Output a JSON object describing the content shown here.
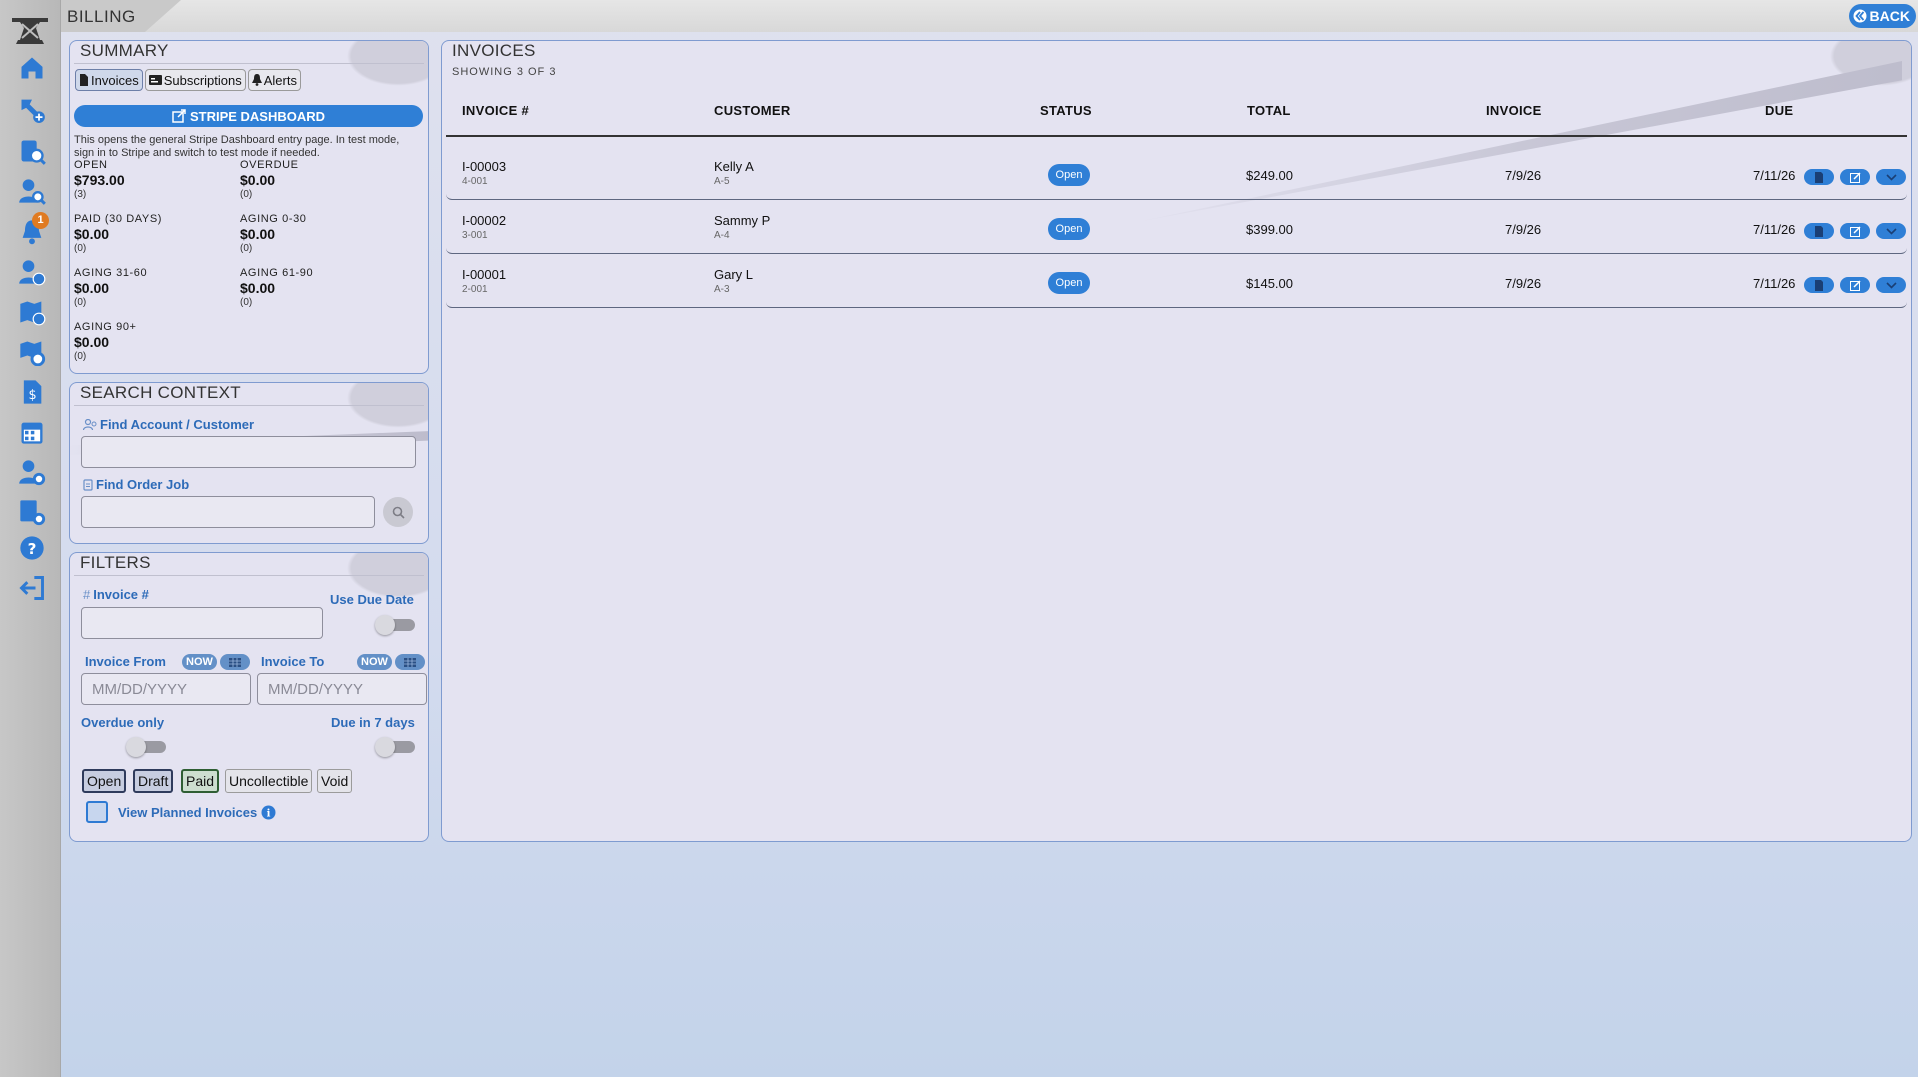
{
  "app": {
    "title": "BILLING",
    "back_label": "BACK",
    "notification_count": "1"
  },
  "nav": {
    "items": [
      "home-icon",
      "tool-add-icon",
      "clipboard-search-icon",
      "user-search-icon",
      "bell-icon",
      "user-chart-icon",
      "map-pin-icon",
      "map-gear-icon",
      "invoice-dollar-icon",
      "calendar-icon",
      "user-gear-icon",
      "grid-gear-icon",
      "help-icon",
      "logout-icon"
    ]
  },
  "summary": {
    "title": "SUMMARY",
    "tabs": [
      {
        "label": "Invoices",
        "active": true
      },
      {
        "label": "Subscriptions",
        "active": false
      },
      {
        "label": "Alerts",
        "active": false
      }
    ],
    "stripe_label": "STRIPE DASHBOARD",
    "stripe_note": "This opens the general Stripe Dashboard entry page. In test mode, sign in to Stripe and switch to test mode if needed.",
    "stats": [
      {
        "label": "OPEN",
        "value": "$793.00",
        "count": "(3)"
      },
      {
        "label": "OVERDUE",
        "value": "$0.00",
        "count": "(0)"
      },
      {
        "label": "PAID (30 DAYS)",
        "value": "$0.00",
        "count": "(0)"
      },
      {
        "label": "AGING 0-30",
        "value": "$0.00",
        "count": "(0)"
      },
      {
        "label": "AGING 31-60",
        "value": "$0.00",
        "count": "(0)"
      },
      {
        "label": "AGING 61-90",
        "value": "$0.00",
        "count": "(0)"
      },
      {
        "label": "AGING 90+",
        "value": "$0.00",
        "count": "(0)"
      }
    ]
  },
  "search": {
    "title": "SEARCH CONTEXT",
    "account_label": "Find Account / Customer",
    "account_value": "",
    "order_label": "Find Order Job",
    "order_value": ""
  },
  "filters": {
    "title": "FILTERS",
    "invoice_label": "Invoice #",
    "use_due_date_label": "Use Due Date",
    "from_label": "Invoice From",
    "to_label": "Invoice To",
    "now_label": "NOW",
    "date_placeholder": "MM/DD/YYYY",
    "overdue_label": "Overdue only",
    "due7_label": "Due in 7 days",
    "statuses": [
      "Open",
      "Draft",
      "Paid",
      "Uncollectible",
      "Void"
    ],
    "planned_label": "View Planned Invoices"
  },
  "invoices": {
    "title": "INVOICES",
    "showing": "SHOWING 3 OF 3",
    "columns": [
      "INVOICE #",
      "CUSTOMER",
      "STATUS",
      "TOTAL",
      "INVOICE",
      "DUE"
    ],
    "rows": [
      {
        "number": "I-00003",
        "sub": "4-001",
        "customer": "Kelly A",
        "customer_sub": "A-5",
        "status": "Open",
        "total": "$249.00",
        "invoice_date": "7/9/26",
        "due": "7/11/26"
      },
      {
        "number": "I-00002",
        "sub": "3-001",
        "customer": "Sammy P",
        "customer_sub": "A-4",
        "status": "Open",
        "total": "$399.00",
        "invoice_date": "7/9/26",
        "due": "7/11/26"
      },
      {
        "number": "I-00001",
        "sub": "2-001",
        "customer": "Gary L",
        "customer_sub": "A-3",
        "status": "Open",
        "total": "$145.00",
        "invoice_date": "7/9/26",
        "due": "7/11/26"
      }
    ]
  },
  "colors": {
    "accent": "#2f7fd6",
    "label_blue": "#2d6bb8",
    "panel_bg": "#e4e3f1",
    "panel_border": "#7f9bd0",
    "badge": "#e07b22"
  }
}
